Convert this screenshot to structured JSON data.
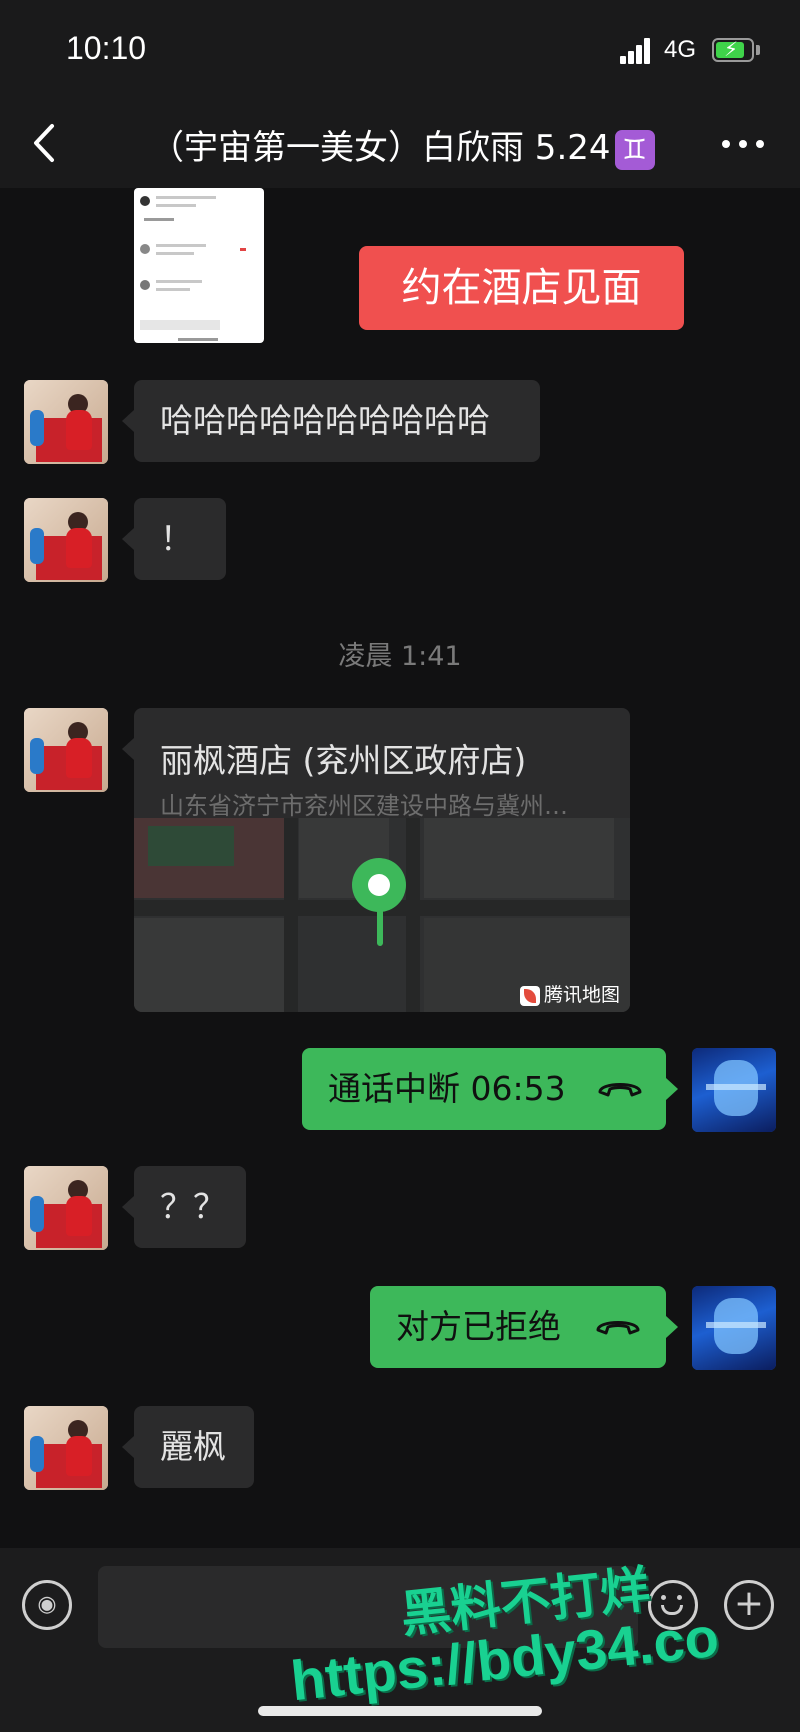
{
  "status_bar": {
    "time": "10:10",
    "network": "4G"
  },
  "header": {
    "title": "（宇宙第一美女）白欣雨 5.24",
    "badge": "♊"
  },
  "banner": {
    "text": "约在酒店见面"
  },
  "messages": [
    {
      "from": "them",
      "text": "哈哈哈哈哈哈哈哈哈哈"
    },
    {
      "from": "them",
      "text": "！"
    },
    {
      "from": "them",
      "text": "？？"
    },
    {
      "from": "them",
      "text": "麗枫"
    }
  ],
  "timestamp": "凌晨 1:41",
  "location": {
    "name": "丽枫酒店 (兖州区政府店)",
    "address": "山东省济宁市兖州区建设中路与冀州…",
    "provider": "腾讯地图"
  },
  "calls": [
    {
      "text": "通话中断 06:53"
    },
    {
      "text": "对方已拒绝"
    }
  ],
  "watermark": {
    "line1": "黑料不打烊",
    "line2": "https://bdy34.co"
  },
  "colors": {
    "sent_bubble": "#3db85a",
    "received_bubble": "#2b2b2c",
    "banner": "#f0504f",
    "background": "#111112"
  }
}
